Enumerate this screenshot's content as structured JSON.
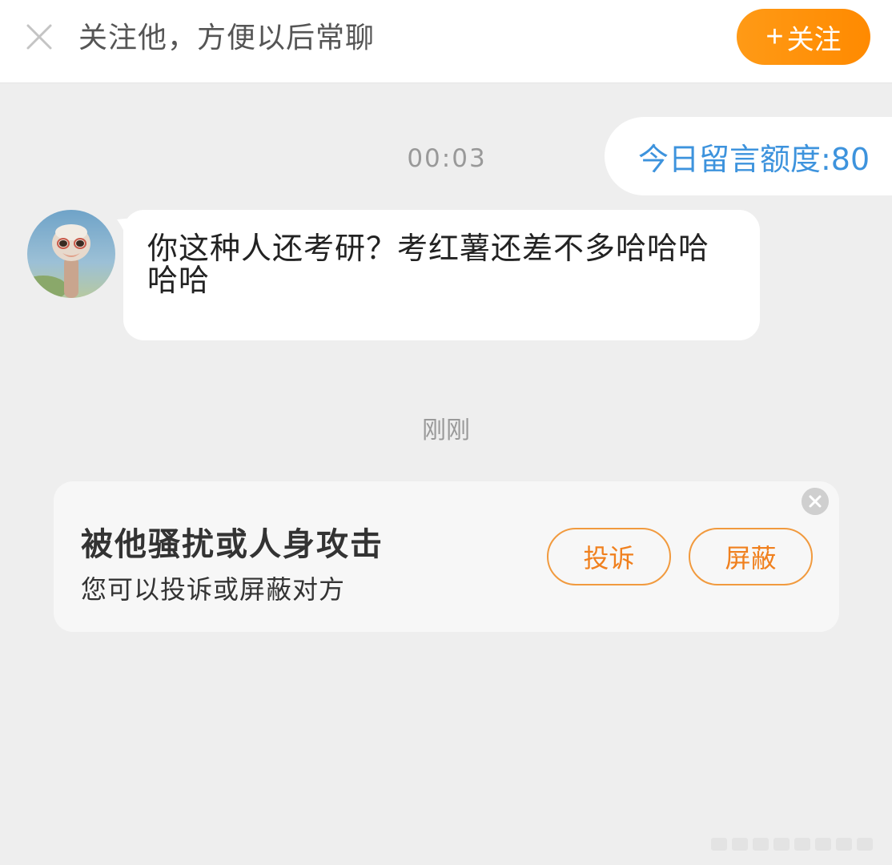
{
  "header": {
    "title": "关注他，方便以后常聊",
    "follow_plus": "+",
    "follow_label": "关注",
    "close_icon": "close-icon"
  },
  "conversation": {
    "quota_text": "今日留言额度:80",
    "timestamp_1": "00:03",
    "message_text": "你这种人还考研？考红薯还差不多哈哈哈哈哈",
    "timestamp_2": "刚刚"
  },
  "report_card": {
    "title": "被他骚扰或人身攻击",
    "subtitle": "您可以投诉或屏蔽对方",
    "complain_label": "投诉",
    "block_label": "屏蔽",
    "close_icon": "close-circle-icon"
  },
  "colors": {
    "accent_orange": "#ff8f0a",
    "link_blue": "#3d93dd",
    "background": "#eeeeee"
  }
}
